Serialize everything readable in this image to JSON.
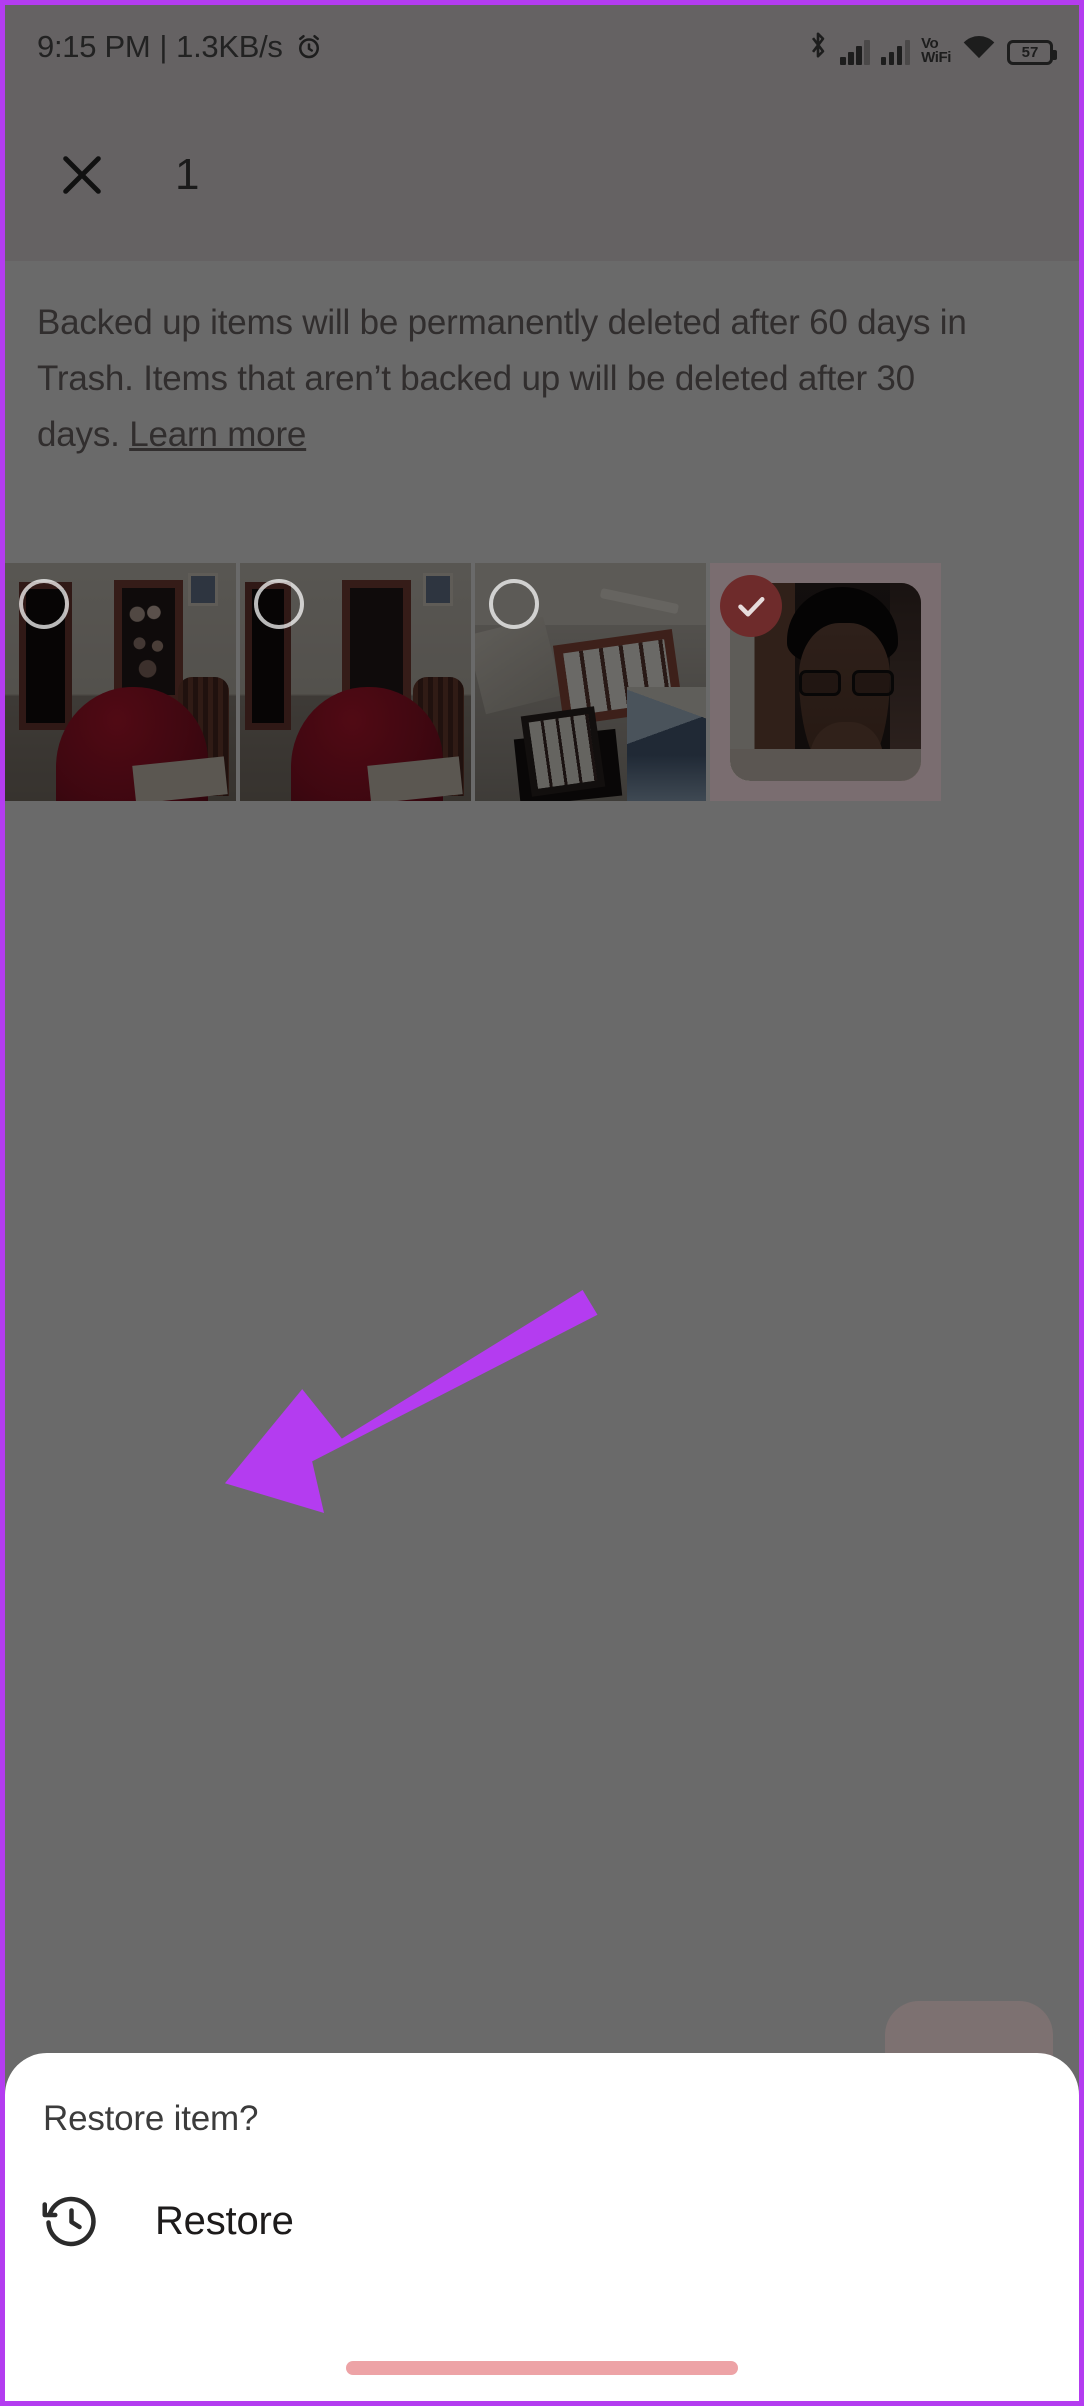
{
  "theme": {
    "accent_purple": "#b43cf0",
    "scrim_gray": "#6a6a6a",
    "sheet_white": "#ffffff",
    "selection_red": "#6e2b2b",
    "home_indicator_pink": "#eda3a6"
  },
  "status_bar": {
    "time": "9:15 PM",
    "separator": "|",
    "network_speed": "1.3KB/s",
    "alarm_icon": "alarm-icon",
    "bluetooth_icon": "bluetooth-icon",
    "signal_1_icon": "signal-bars-icon",
    "signal_2_icon": "signal-bars-icon",
    "vo_line1": "Vo",
    "vo_line2": "WiFi",
    "wifi_icon": "wifi-icon",
    "battery_level": "57"
  },
  "app_bar": {
    "close_icon": "close-icon",
    "selected_count": "1"
  },
  "trash_note": {
    "line": "Backed up items will be permanently deleted after 60 days in Trash. Items that aren’t backed up will be deleted after 30 days.",
    "link_label": "Learn more"
  },
  "grid": {
    "items": [
      {
        "name": "photo-room-cabinet-1",
        "selected": false,
        "style": "room"
      },
      {
        "name": "photo-room-cabinet-2",
        "selected": false,
        "style": "room"
      },
      {
        "name": "photo-room-window-clothes",
        "selected": false,
        "style": "window"
      },
      {
        "name": "photo-selfie-portrait",
        "selected": true,
        "style": "selfie"
      }
    ]
  },
  "fab": {
    "icon": "delete-icon"
  },
  "bottom_sheet": {
    "title": "Restore item?",
    "restore_icon": "history-restore-icon",
    "restore_label": "Restore"
  },
  "annotation": {
    "arrow_icon": "pointer-arrow-icon",
    "arrow_color": "#b43cf0"
  }
}
